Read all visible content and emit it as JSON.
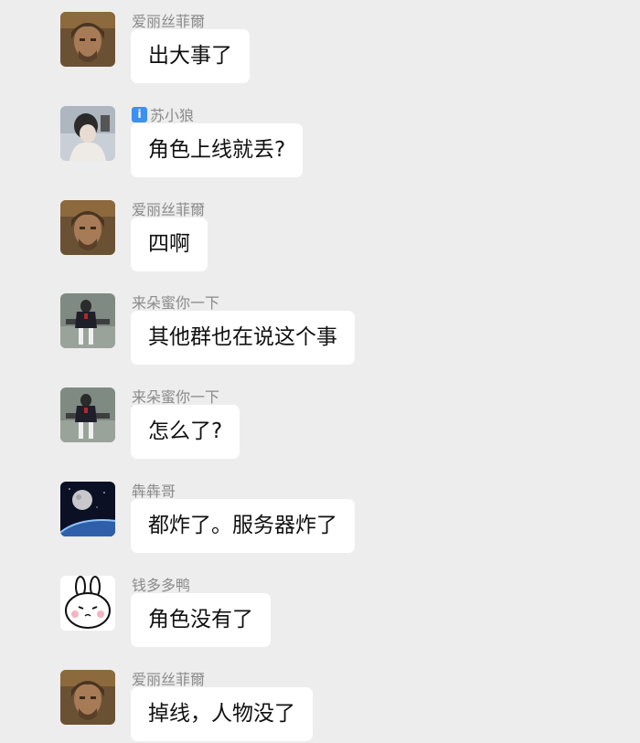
{
  "messages": [
    {
      "sender": "爱丽丝菲爾",
      "text": "出大事了",
      "avatar": "man-portrait-avatar"
    },
    {
      "sender": "苏小狼",
      "text": "角色上线就丢?",
      "avatar": "girl-photo-avatar",
      "badge": "i"
    },
    {
      "sender": "爱丽丝菲爾",
      "text": "四啊",
      "avatar": "man-portrait-avatar"
    },
    {
      "sender": "来朵蜜你一下",
      "text": "其他群也在说这个事",
      "avatar": "figure-sitting-avatar"
    },
    {
      "sender": "来朵蜜你一下",
      "text": "怎么了?",
      "avatar": "figure-sitting-avatar"
    },
    {
      "sender": "犇犇哥",
      "text": "都炸了。服务器炸了",
      "avatar": "planet-space-avatar"
    },
    {
      "sender": "钱多多鸭",
      "text": "角色没有了",
      "avatar": "bunny-cartoon-avatar"
    },
    {
      "sender": "爱丽丝菲爾",
      "text": "掉线，人物没了",
      "avatar": "man-portrait-avatar"
    }
  ]
}
